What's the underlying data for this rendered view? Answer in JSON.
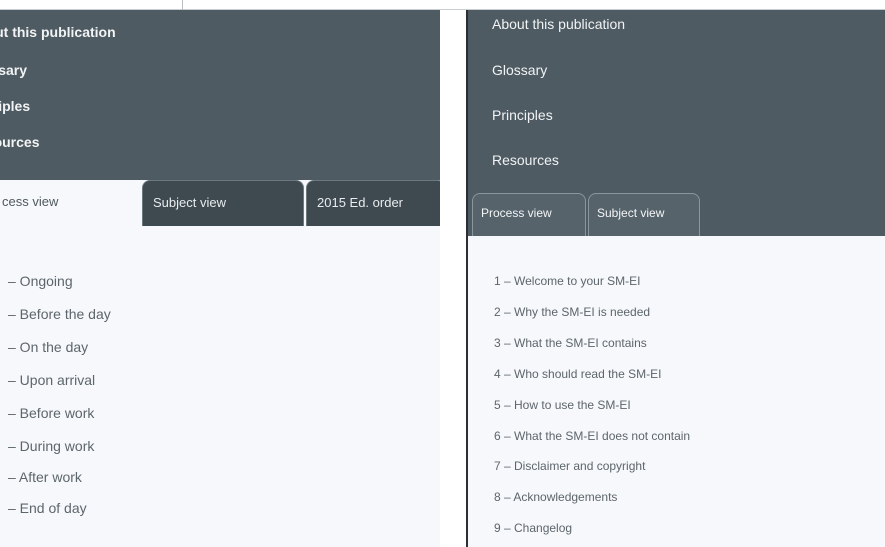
{
  "left_panel": {
    "menu": [
      "bout this publication",
      "lossary",
      "inciples",
      "esources"
    ],
    "tabs": [
      "cess view",
      "Subject view",
      "2015 Ed. order"
    ],
    "items": [
      "– Ongoing",
      "– Before the day",
      "– On the day",
      "– Upon arrival",
      "– Before work",
      "– During work",
      "– After work",
      "– End of day"
    ]
  },
  "right_panel": {
    "menu": [
      "About this publication",
      "Glossary",
      "Principles",
      "Resources"
    ],
    "tabs": [
      "Process view",
      "Subject view"
    ],
    "items": [
      "1 – Welcome to your SM-EI",
      "2 – Why the SM-EI is needed",
      "3 – What the SM-EI contains",
      "4 – Who should read the SM-EI",
      "5 – How to use the SM-EI",
      "6 – What the SM-EI does not contain",
      "7 – Disclaimer and copyright",
      "8 – Acknowledgements",
      "9 – Changelog"
    ]
  },
  "colors": {
    "header_bg": "#4e5b62",
    "tab_inactive_bg": "#3e4a50",
    "content_bg": "#f6f8fb",
    "text_muted": "#5d666c"
  }
}
